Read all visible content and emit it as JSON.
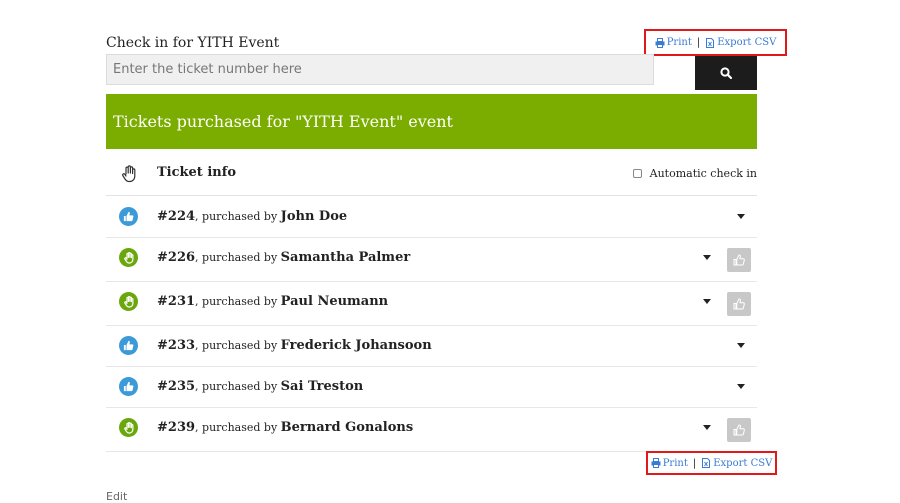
{
  "checkin": {
    "title": "Check in for YITH Event",
    "placeholder": "Enter the ticket number here"
  },
  "export": {
    "print_label": "Print",
    "separator": "|",
    "csv_label": "Export CSV"
  },
  "banner": {
    "text": "Tickets purchased for \"YITH Event\" event",
    "color": "#7aad00"
  },
  "table_header": {
    "label": "Ticket info",
    "auto_checkin_label": "Automatic check in"
  },
  "purchased_by": ", purchased by ",
  "tickets": [
    {
      "number": "#224",
      "buyer": "John Doe",
      "status": "blue"
    },
    {
      "number": "#226",
      "buyer": "Samantha Palmer",
      "status": "green"
    },
    {
      "number": "#231",
      "buyer": "Paul Neumann",
      "status": "green"
    },
    {
      "number": "#233",
      "buyer": "Frederick Johansoon",
      "status": "blue"
    },
    {
      "number": "#235",
      "buyer": "Sai Treston",
      "status": "blue"
    },
    {
      "number": "#239",
      "buyer": "Bernard Gonalons",
      "status": "green"
    }
  ],
  "edit_label": "Edit",
  "icons": {
    "print": "printer-icon",
    "csv": "file-icon",
    "search": "search-icon",
    "header": "hand-icon",
    "checked_in": "thumbs-up-icon",
    "not_checked_in": "hand-icon",
    "checkin_button": "thumbs-up-icon",
    "expand": "caret-down-icon"
  },
  "colors": {
    "blue_status": "#3d9ad8",
    "green_status": "#6aa70c",
    "highlight": "#e0191a",
    "link": "#3a7bd5"
  }
}
